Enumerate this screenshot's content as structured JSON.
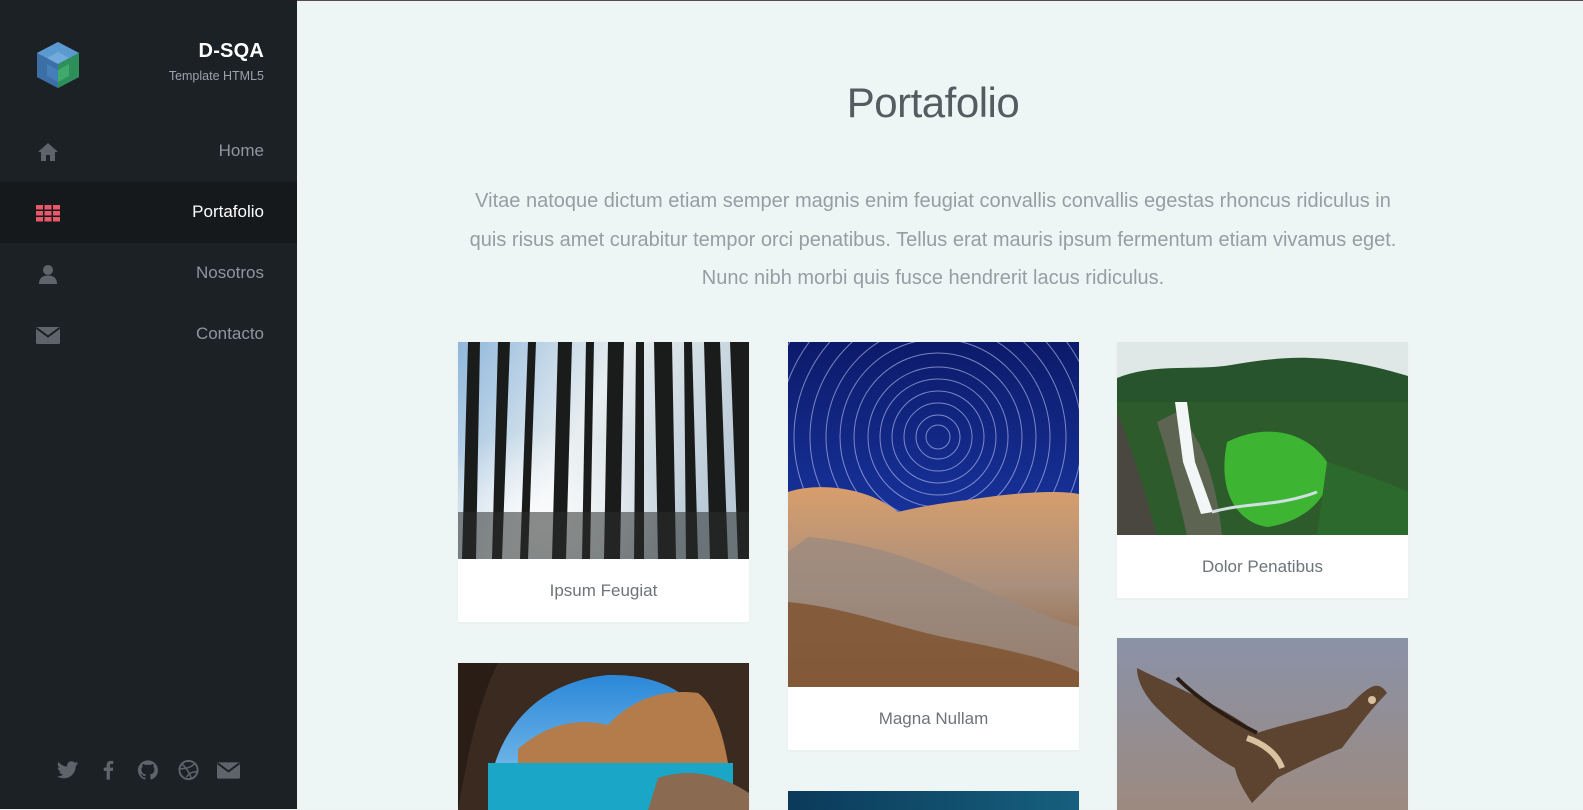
{
  "brand": {
    "name": "D-SQA",
    "subtitle": "Template HTML5"
  },
  "nav": {
    "items": [
      {
        "label": "Home",
        "icon": "home-icon",
        "active": false
      },
      {
        "label": "Portafolio",
        "icon": "grid-icon",
        "active": true
      },
      {
        "label": "Nosotros",
        "icon": "user-icon",
        "active": false
      },
      {
        "label": "Contacto",
        "icon": "envelope-icon",
        "active": false
      }
    ]
  },
  "social": [
    "twitter-icon",
    "facebook-icon",
    "github-icon",
    "dribbble-icon",
    "envelope-icon"
  ],
  "colors": {
    "sidebar_bg": "#1c2125",
    "active_bg": "#15191c",
    "accent": "#e8586a",
    "page_bg": "#eef5f5"
  },
  "main": {
    "title": "Portafolio",
    "intro": "Vitae natoque dictum etiam semper magnis enim feugiat convallis convallis egestas rhoncus ridiculus in quis risus amet curabitur tempor orci penatibus. Tellus erat mauris ipsum fermentum etiam vivamus eget. Nunc nibh morbi quis fusce hendrerit lacus ridiculus.",
    "items": [
      {
        "caption": "Ipsum Feugiat",
        "image": "forest"
      },
      {
        "caption": "Magna Nullam",
        "image": "star-trails-rocks"
      },
      {
        "caption": "Dolor Penatibus",
        "image": "waterfall"
      },
      {
        "caption": "",
        "image": "sea-cave"
      },
      {
        "caption": "",
        "image": "night-sky"
      },
      {
        "caption": "",
        "image": "vulture"
      }
    ]
  }
}
